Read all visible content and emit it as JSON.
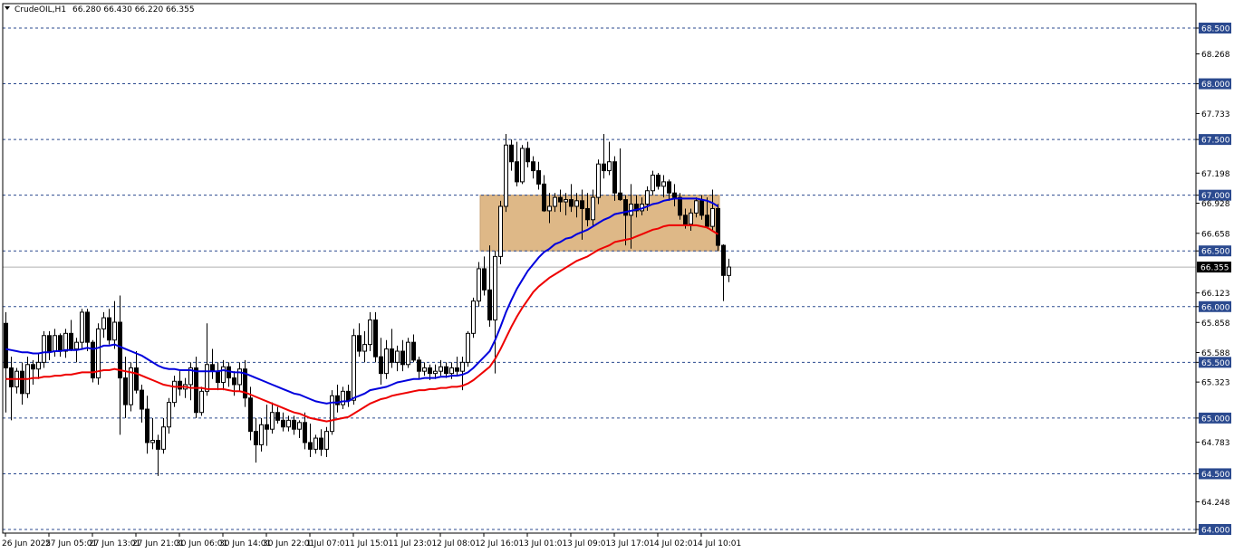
{
  "header": {
    "symbol": "CrudeOIL,H1",
    "ohlc": "66.280 66.430 66.220 66.355",
    "menu_icon": "triangle-down-icon"
  },
  "colors": {
    "up_body": "#ffffff",
    "down_body": "#000000",
    "wick": "#000000",
    "ema_fast": "#0000dd",
    "ema_slow": "#ee0000",
    "level_line": "#2b4a8f",
    "zone_fill": "#deb887",
    "price_label_bg": "#000000",
    "price_label_text": "#ffffff",
    "current_price_line": "#b0b0b0"
  },
  "chart_data": {
    "type": "candlestick",
    "timeframe": "H1",
    "ylim": [
      64.0,
      68.6
    ],
    "y_ticks": [
      {
        "value": 68.5,
        "label": "68.500",
        "boxed": true
      },
      {
        "value": 68.268,
        "label": "68.268",
        "boxed": false
      },
      {
        "value": 68.0,
        "label": "68.000",
        "boxed": true
      },
      {
        "value": 67.733,
        "label": "67.733",
        "boxed": false
      },
      {
        "value": 67.5,
        "label": "67.500",
        "boxed": true
      },
      {
        "value": 67.198,
        "label": "67.198",
        "boxed": false
      },
      {
        "value": 67.0,
        "label": "67.000",
        "boxed": true
      },
      {
        "value": 66.928,
        "label": "66.928",
        "boxed": false
      },
      {
        "value": 66.658,
        "label": "66.658",
        "boxed": false
      },
      {
        "value": 66.5,
        "label": "66.500",
        "boxed": true
      },
      {
        "value": 66.123,
        "label": "66.123",
        "boxed": false
      },
      {
        "value": 66.0,
        "label": "66.000",
        "boxed": true
      },
      {
        "value": 65.858,
        "label": "65.858",
        "boxed": false
      },
      {
        "value": 65.588,
        "label": "65.588",
        "boxed": false
      },
      {
        "value": 65.5,
        "label": "65.500",
        "boxed": true
      },
      {
        "value": 65.323,
        "label": "65.323",
        "boxed": false
      },
      {
        "value": 65.0,
        "label": "65.000",
        "boxed": true
      },
      {
        "value": 64.783,
        "label": "64.783",
        "boxed": false
      },
      {
        "value": 64.5,
        "label": "64.500",
        "boxed": true
      },
      {
        "value": 64.248,
        "label": "64.248",
        "boxed": false
      },
      {
        "value": 64.0,
        "label": "64.000",
        "boxed": true
      }
    ],
    "horizontal_levels": [
      68.5,
      68.0,
      67.5,
      67.0,
      66.5,
      66.0,
      65.5,
      65.0,
      64.5,
      64.0
    ],
    "zone": {
      "from_index": 88,
      "to_index": 131,
      "low": 66.5,
      "high": 67.0
    },
    "current_price": {
      "value": 66.355,
      "label": "66.355"
    },
    "x_labels": [
      {
        "index": 0,
        "label": "26 Jun 2025"
      },
      {
        "index": 8,
        "label": "27 Jun 05:01"
      },
      {
        "index": 16,
        "label": "27 Jun 13:01"
      },
      {
        "index": 24,
        "label": "27 Jun 21:01"
      },
      {
        "index": 32,
        "label": "30 Jun 06:01"
      },
      {
        "index": 40,
        "label": "30 Jun 14:01"
      },
      {
        "index": 48,
        "label": "30 Jun 22:01"
      },
      {
        "index": 56,
        "label": "1 Jul 07:01"
      },
      {
        "index": 64,
        "label": "1 Jul 15:01"
      },
      {
        "index": 72,
        "label": "1 Jul 23:01"
      },
      {
        "index": 80,
        "label": "2 Jul 08:01"
      },
      {
        "index": 88,
        "label": "2 Jul 16:01"
      },
      {
        "index": 96,
        "label": "3 Jul 01:01"
      },
      {
        "index": 104,
        "label": "3 Jul 09:01"
      },
      {
        "index": 112,
        "label": "3 Jul 17:01"
      },
      {
        "index": 120,
        "label": "4 Jul 02:01"
      },
      {
        "index": 128,
        "label": "4 Jul 10:01"
      }
    ],
    "candles": [
      [
        65.85,
        65.95,
        65.05,
        65.45
      ],
      [
        65.45,
        65.55,
        64.98,
        65.28
      ],
      [
        65.28,
        65.45,
        65.22,
        65.42
      ],
      [
        65.42,
        65.5,
        65.12,
        65.22
      ],
      [
        65.22,
        65.55,
        65.18,
        65.48
      ],
      [
        65.48,
        65.52,
        65.3,
        65.44
      ],
      [
        65.44,
        65.58,
        65.35,
        65.5
      ],
      [
        65.5,
        65.78,
        65.45,
        65.74
      ],
      [
        65.74,
        65.78,
        65.52,
        65.6
      ],
      [
        65.6,
        65.8,
        65.55,
        65.74
      ],
      [
        65.74,
        65.76,
        65.55,
        65.6
      ],
      [
        65.6,
        65.8,
        65.54,
        65.76
      ],
      [
        65.76,
        65.88,
        65.6,
        65.62
      ],
      [
        65.62,
        65.72,
        65.5,
        65.68
      ],
      [
        65.68,
        65.98,
        65.62,
        65.95
      ],
      [
        65.95,
        65.98,
        65.6,
        65.68
      ],
      [
        65.68,
        65.7,
        65.32,
        65.36
      ],
      [
        65.36,
        65.85,
        65.3,
        65.8
      ],
      [
        65.8,
        65.95,
        65.72,
        65.9
      ],
      [
        65.9,
        65.98,
        65.66,
        65.7
      ],
      [
        65.7,
        66.05,
        65.62,
        65.86
      ],
      [
        65.86,
        66.1,
        64.85,
        65.36
      ],
      [
        65.36,
        65.55,
        65.0,
        65.12
      ],
      [
        65.12,
        65.5,
        65.06,
        65.45
      ],
      [
        65.45,
        65.6,
        65.22,
        65.25
      ],
      [
        65.25,
        65.3,
        64.96,
        65.08
      ],
      [
        65.08,
        65.2,
        64.68,
        64.78
      ],
      [
        64.78,
        65.0,
        64.72,
        64.8
      ],
      [
        64.8,
        64.85,
        64.48,
        64.72
      ],
      [
        64.72,
        65.0,
        64.68,
        64.92
      ],
      [
        64.92,
        65.18,
        64.86,
        65.14
      ],
      [
        65.14,
        65.38,
        65.1,
        65.33
      ],
      [
        65.33,
        65.42,
        65.2,
        65.26
      ],
      [
        65.26,
        65.36,
        65.18,
        65.3
      ],
      [
        65.3,
        65.5,
        65.16,
        65.45
      ],
      [
        65.45,
        65.55,
        65.0,
        65.05
      ],
      [
        65.05,
        65.28,
        65.02,
        65.24
      ],
      [
        65.24,
        65.85,
        65.2,
        65.48
      ],
      [
        65.48,
        65.62,
        65.35,
        65.42
      ],
      [
        65.42,
        65.5,
        65.25,
        65.32
      ],
      [
        65.32,
        65.52,
        65.25,
        65.46
      ],
      [
        65.46,
        65.5,
        65.28,
        65.36
      ],
      [
        65.36,
        65.42,
        65.2,
        65.3
      ],
      [
        65.3,
        65.5,
        65.24,
        65.44
      ],
      [
        65.44,
        65.52,
        65.1,
        65.18
      ],
      [
        65.18,
        65.28,
        64.8,
        64.88
      ],
      [
        64.88,
        65.0,
        64.6,
        64.76
      ],
      [
        64.76,
        65.0,
        64.7,
        64.94
      ],
      [
        64.94,
        65.12,
        64.75,
        64.9
      ],
      [
        64.9,
        65.14,
        64.86,
        65.05
      ],
      [
        65.05,
        65.1,
        64.95,
        64.98
      ],
      [
        64.98,
        65.05,
        64.88,
        64.92
      ],
      [
        64.92,
        65.02,
        64.88,
        64.98
      ],
      [
        64.98,
        65.02,
        64.85,
        64.9
      ],
      [
        64.9,
        64.98,
        64.82,
        64.96
      ],
      [
        64.96,
        65.05,
        64.72,
        64.78
      ],
      [
        64.78,
        64.95,
        64.65,
        64.72
      ],
      [
        64.72,
        64.85,
        64.68,
        64.82
      ],
      [
        64.82,
        64.9,
        64.66,
        64.72
      ],
      [
        64.72,
        64.92,
        64.65,
        64.88
      ],
      [
        64.88,
        65.25,
        64.85,
        65.2
      ],
      [
        65.2,
        65.3,
        65.05,
        65.12
      ],
      [
        65.12,
        65.28,
        65.08,
        65.24
      ],
      [
        65.24,
        65.3,
        65.1,
        65.16
      ],
      [
        65.16,
        65.8,
        65.12,
        65.74
      ],
      [
        65.74,
        65.85,
        65.55,
        65.6
      ],
      [
        65.6,
        65.78,
        65.5,
        65.66
      ],
      [
        65.66,
        65.95,
        65.6,
        65.88
      ],
      [
        65.88,
        65.95,
        65.5,
        65.55
      ],
      [
        65.55,
        65.72,
        65.3,
        65.4
      ],
      [
        65.4,
        65.7,
        65.35,
        65.62
      ],
      [
        65.62,
        65.8,
        65.45,
        65.5
      ],
      [
        65.5,
        65.65,
        65.42,
        65.6
      ],
      [
        65.6,
        65.7,
        65.42,
        65.48
      ],
      [
        65.48,
        65.72,
        65.45,
        65.68
      ],
      [
        65.68,
        65.75,
        65.5,
        65.52
      ],
      [
        65.52,
        65.55,
        65.35,
        65.42
      ],
      [
        65.42,
        65.5,
        65.38,
        65.45
      ],
      [
        65.45,
        65.48,
        65.34,
        65.4
      ],
      [
        65.4,
        65.48,
        65.35,
        65.42
      ],
      [
        65.42,
        65.52,
        65.38,
        65.46
      ],
      [
        65.46,
        65.5,
        65.36,
        65.4
      ],
      [
        65.4,
        65.5,
        65.35,
        65.45
      ],
      [
        65.45,
        65.55,
        65.38,
        65.42
      ],
      [
        65.42,
        65.55,
        65.25,
        65.5
      ],
      [
        65.5,
        65.78,
        65.46,
        65.76
      ],
      [
        65.76,
        66.08,
        65.72,
        66.05
      ],
      [
        66.05,
        66.4,
        66.0,
        66.34
      ],
      [
        66.34,
        66.45,
        66.1,
        66.15
      ],
      [
        66.15,
        66.55,
        65.82,
        65.88
      ],
      [
        65.88,
        66.5,
        65.4,
        66.45
      ],
      [
        66.45,
        66.95,
        66.38,
        66.9
      ],
      [
        66.9,
        67.55,
        66.85,
        67.45
      ],
      [
        67.45,
        67.5,
        67.22,
        67.3
      ],
      [
        67.3,
        67.48,
        67.08,
        67.12
      ],
      [
        67.12,
        67.45,
        67.1,
        67.42
      ],
      [
        67.42,
        67.48,
        67.25,
        67.3
      ],
      [
        67.3,
        67.35,
        67.15,
        67.22
      ],
      [
        67.22,
        67.3,
        67.05,
        67.1
      ],
      [
        67.1,
        67.18,
        66.85,
        66.86
      ],
      [
        66.86,
        67.02,
        66.75,
        66.9
      ],
      [
        66.9,
        67.02,
        66.85,
        66.98
      ],
      [
        66.98,
        67.05,
        66.85,
        66.94
      ],
      [
        66.94,
        67.02,
        66.82,
        66.96
      ],
      [
        66.96,
        67.1,
        66.85,
        66.9
      ],
      [
        66.9,
        67.02,
        66.8,
        66.95
      ],
      [
        66.95,
        67.05,
        66.6,
        66.88
      ],
      [
        66.88,
        67.02,
        66.72,
        66.78
      ],
      [
        66.78,
        67.05,
        66.72,
        66.98
      ],
      [
        66.98,
        67.32,
        66.92,
        67.28
      ],
      [
        67.28,
        67.55,
        67.15,
        67.22
      ],
      [
        67.22,
        67.48,
        67.18,
        67.3
      ],
      [
        67.3,
        67.35,
        66.95,
        67.02
      ],
      [
        67.02,
        67.42,
        66.95,
        66.96
      ],
      [
        66.96,
        67.0,
        66.55,
        66.82
      ],
      [
        66.82,
        67.1,
        66.52,
        66.92
      ],
      [
        66.92,
        67.0,
        66.8,
        66.86
      ],
      [
        66.86,
        66.98,
        66.82,
        66.92
      ],
      [
        66.92,
        67.08,
        66.86,
        67.04
      ],
      [
        67.04,
        67.22,
        67.0,
        67.18
      ],
      [
        67.18,
        67.2,
        67.05,
        67.08
      ],
      [
        67.08,
        67.18,
        66.98,
        67.12
      ],
      [
        67.12,
        67.14,
        66.95,
        67.02
      ],
      [
        67.02,
        67.1,
        66.9,
        66.98
      ],
      [
        66.98,
        67.02,
        66.78,
        66.82
      ],
      [
        66.82,
        66.88,
        66.7,
        66.74
      ],
      [
        66.74,
        66.88,
        66.68,
        66.84
      ],
      [
        66.84,
        66.98,
        66.8,
        66.95
      ],
      [
        66.95,
        67.0,
        66.78,
        66.82
      ],
      [
        66.82,
        66.98,
        66.7,
        66.72
      ],
      [
        66.72,
        67.05,
        66.68,
        66.88
      ],
      [
        66.88,
        66.92,
        66.5,
        66.55
      ],
      [
        66.55,
        66.56,
        66.05,
        66.28
      ],
      [
        66.28,
        66.43,
        66.22,
        66.355
      ]
    ],
    "series": [
      {
        "type": "ema",
        "color_key": "ema_fast",
        "values": [
          65.62,
          65.61,
          65.6,
          65.59,
          65.59,
          65.58,
          65.58,
          65.59,
          65.59,
          65.6,
          65.6,
          65.61,
          65.61,
          65.61,
          65.62,
          65.63,
          65.62,
          65.63,
          65.65,
          65.65,
          65.66,
          65.64,
          65.62,
          65.6,
          65.58,
          65.56,
          65.53,
          65.5,
          65.47,
          65.45,
          65.44,
          65.44,
          65.43,
          65.43,
          65.43,
          65.42,
          65.42,
          65.42,
          65.42,
          65.42,
          65.43,
          65.42,
          65.41,
          65.41,
          65.4,
          65.38,
          65.36,
          65.34,
          65.32,
          65.3,
          65.28,
          65.26,
          65.24,
          65.22,
          65.21,
          65.19,
          65.17,
          65.15,
          65.14,
          65.13,
          65.14,
          65.14,
          65.15,
          65.15,
          65.18,
          65.2,
          65.22,
          65.25,
          65.26,
          65.27,
          65.28,
          65.3,
          65.32,
          65.33,
          65.34,
          65.35,
          65.35,
          65.36,
          65.36,
          65.36,
          65.37,
          65.37,
          65.38,
          65.38,
          65.39,
          65.41,
          65.45,
          65.5,
          65.55,
          65.6,
          65.7,
          65.82,
          65.95,
          66.06,
          66.16,
          66.24,
          66.32,
          66.38,
          66.44,
          66.49,
          66.52,
          66.56,
          66.58,
          66.61,
          66.62,
          66.65,
          66.67,
          66.69,
          66.72,
          66.75,
          66.78,
          66.8,
          66.83,
          66.84,
          66.85,
          66.86,
          66.87,
          66.88,
          66.9,
          66.92,
          66.93,
          66.95,
          66.96,
          66.97,
          66.97,
          66.97,
          66.97,
          66.97,
          66.96,
          66.95,
          66.93,
          66.9
        ]
      },
      {
        "type": "ema",
        "color_key": "ema_slow",
        "values": [
          65.35,
          65.35,
          65.35,
          65.35,
          65.35,
          65.36,
          65.36,
          65.37,
          65.37,
          65.38,
          65.38,
          65.39,
          65.39,
          65.4,
          65.41,
          65.41,
          65.41,
          65.42,
          65.43,
          65.43,
          65.44,
          65.43,
          65.42,
          65.41,
          65.4,
          65.38,
          65.36,
          65.34,
          65.32,
          65.3,
          65.29,
          65.28,
          65.28,
          65.28,
          65.27,
          65.27,
          65.27,
          65.26,
          65.26,
          65.26,
          65.26,
          65.25,
          65.24,
          65.24,
          65.23,
          65.21,
          65.19,
          65.17,
          65.15,
          65.13,
          65.11,
          65.09,
          65.07,
          65.05,
          65.04,
          65.02,
          65.0,
          64.99,
          64.98,
          64.97,
          64.98,
          64.99,
          65.0,
          65.01,
          65.04,
          65.07,
          65.1,
          65.13,
          65.15,
          65.17,
          65.18,
          65.2,
          65.21,
          65.22,
          65.23,
          65.24,
          65.25,
          65.25,
          65.26,
          65.26,
          65.27,
          65.27,
          65.28,
          65.28,
          65.29,
          65.31,
          65.34,
          65.38,
          65.42,
          65.46,
          65.53,
          65.62,
          65.72,
          65.82,
          65.91,
          65.99,
          66.06,
          66.13,
          66.18,
          66.22,
          66.26,
          66.29,
          66.32,
          66.35,
          66.38,
          66.41,
          66.43,
          66.45,
          66.48,
          66.51,
          66.53,
          66.55,
          66.58,
          66.59,
          66.6,
          66.61,
          66.63,
          66.65,
          66.67,
          66.69,
          66.7,
          66.72,
          66.73,
          66.73,
          66.73,
          66.73,
          66.73,
          66.73,
          66.72,
          66.71,
          66.68,
          66.65
        ]
      }
    ]
  }
}
